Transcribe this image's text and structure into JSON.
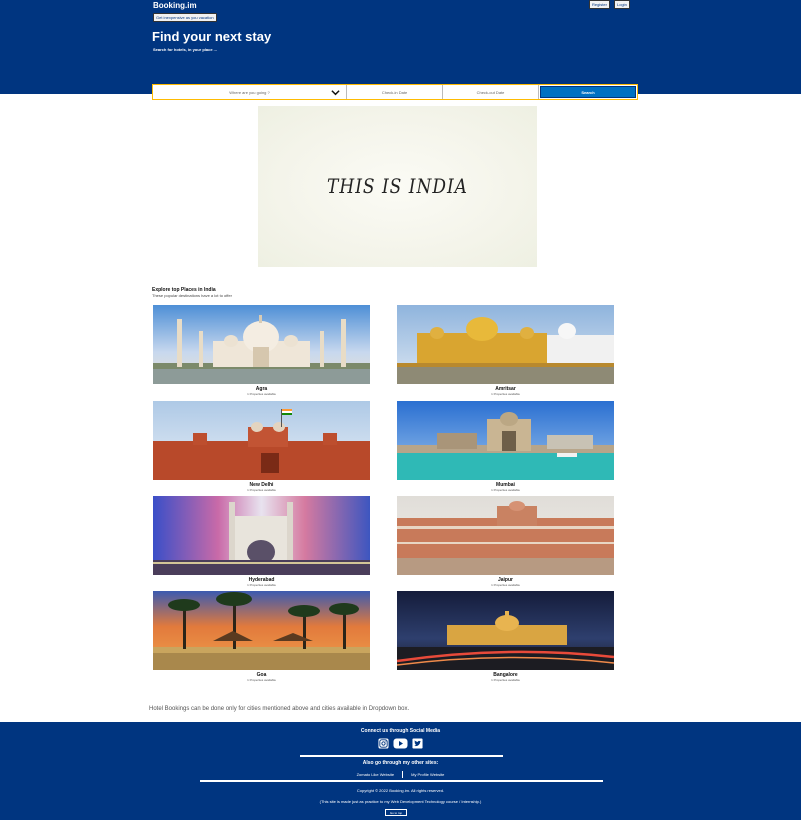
{
  "header": {
    "brand": "Booking.im",
    "hero_button": "Get inexpensive as you vacation",
    "register": "Register",
    "login": "Login",
    "title": "Find your next stay",
    "subtitle": "Search for hotels, in your place ..."
  },
  "search": {
    "destination_placeholder": "Where are you going ?",
    "check_in": "Check-in Date",
    "check_out": "Check-out Date",
    "button": "Search"
  },
  "banner": {
    "text": "THIS IS INDIA"
  },
  "explore": {
    "title": "Explore top Places in India",
    "subtitle": "These popular destinations have a lot to offer",
    "cities": [
      {
        "name": "Agra",
        "caption": "1 Properties available"
      },
      {
        "name": "Amritsar",
        "caption": "1 Properties available"
      },
      {
        "name": "New Delhi",
        "caption": "1 Properties available"
      },
      {
        "name": "Mumbai",
        "caption": "1 Properties available"
      },
      {
        "name": "Hyderabad",
        "caption": "1 Properties available"
      },
      {
        "name": "Jaipur",
        "caption": "1 Properties available"
      },
      {
        "name": "Goa",
        "caption": "1 Properties available"
      },
      {
        "name": "Bangalore",
        "caption": "1 Properties available"
      }
    ]
  },
  "note": "Hotel Bookings can be done only for cities mentioned above and cities available in Dropdown box.",
  "footer": {
    "connect": "Connect us through Social Media",
    "icons": [
      "instagram-icon",
      "youtube-icon",
      "twitter-icon"
    ],
    "also": "Also go through my other sites:",
    "links": [
      "Zomato Like Website",
      "My Profile Website"
    ],
    "copyright": "Copyright © 2022 Booking.im. All rights reserved.",
    "made": "(This site is made just as practice to my Web Development Technology course / Internship.)",
    "top_button": "Go to top"
  },
  "colors": {
    "brand_blue": "#003580",
    "button_blue": "#0071c2",
    "search_border": "#febb02"
  }
}
